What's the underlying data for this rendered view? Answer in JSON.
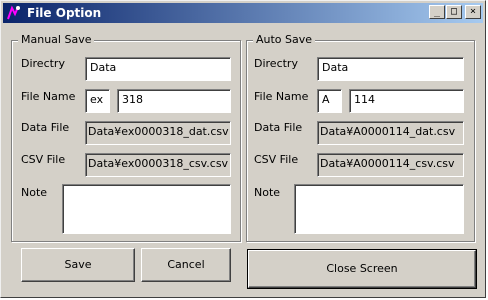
{
  "window": {
    "title": "File Option"
  },
  "manual": {
    "group_label": "Manual Save",
    "directry_label": "Directry",
    "directry_value": "Data",
    "filename_label": "File Name",
    "filename_prefix": "ex",
    "filename_number": "318",
    "datafile_label": "Data File",
    "datafile_value": "Data¥ex0000318_dat.csv",
    "csvfile_label": "CSV File",
    "csvfile_value": "Data¥ex0000318_csv.csv",
    "note_label": "Note",
    "note_value": ""
  },
  "auto": {
    "group_label": "Auto Save",
    "directry_label": "Directry",
    "directry_value": "Data",
    "filename_label": "File Name",
    "filename_prefix": "A",
    "filename_number": "114",
    "datafile_label": "Data File",
    "datafile_value": "Data¥A0000114_dat.csv",
    "csvfile_label": "CSV File",
    "csvfile_value": "Data¥A0000114_csv.csv",
    "note_label": "Note",
    "note_value": ""
  },
  "buttons": {
    "save": "Save",
    "cancel": "Cancel",
    "close_screen": "Close Screen"
  },
  "titlebar_buttons": {
    "minimize": "_",
    "maximize": "□",
    "close": "×"
  },
  "colors": {
    "titlebar_start": "#0a246a",
    "titlebar_end": "#a6caf0",
    "face": "#d4d0c8"
  }
}
